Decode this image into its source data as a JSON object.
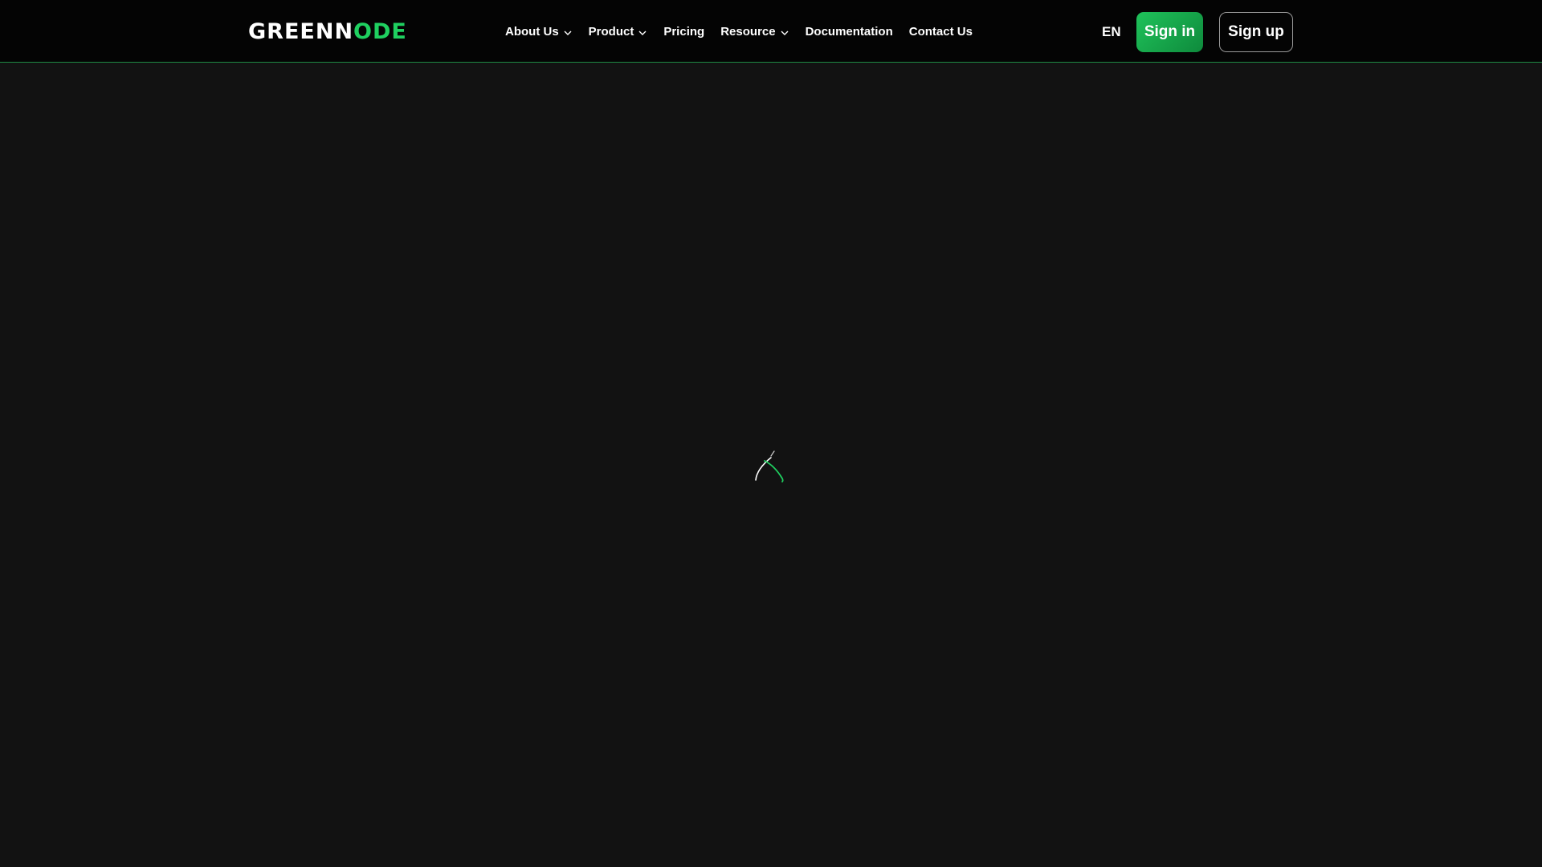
{
  "brand": {
    "logo_part1": "GREEN",
    "logo_part2": "N",
    "logo_part3": "O",
    "logo_part4": "DE",
    "accent_color": "#1fd060",
    "background_color": "#121212",
    "header_color": "#040404"
  },
  "nav": {
    "items": [
      {
        "label": "About Us",
        "has_dropdown": true,
        "icon": "chevron-down-icon"
      },
      {
        "label": "Product",
        "has_dropdown": true,
        "icon": "chevron-down-icon"
      },
      {
        "label": "Pricing",
        "has_dropdown": false
      },
      {
        "label": "Resource",
        "has_dropdown": true,
        "icon": "chevron-down-icon"
      },
      {
        "label": "Documentation",
        "has_dropdown": false
      },
      {
        "label": "Contact Us",
        "has_dropdown": false
      }
    ]
  },
  "header_actions": {
    "language": "EN",
    "sign_in_label": "Sign in",
    "sign_up_label": "Sign up"
  },
  "main": {
    "loading_indicator": "loading-spinner-icon"
  }
}
